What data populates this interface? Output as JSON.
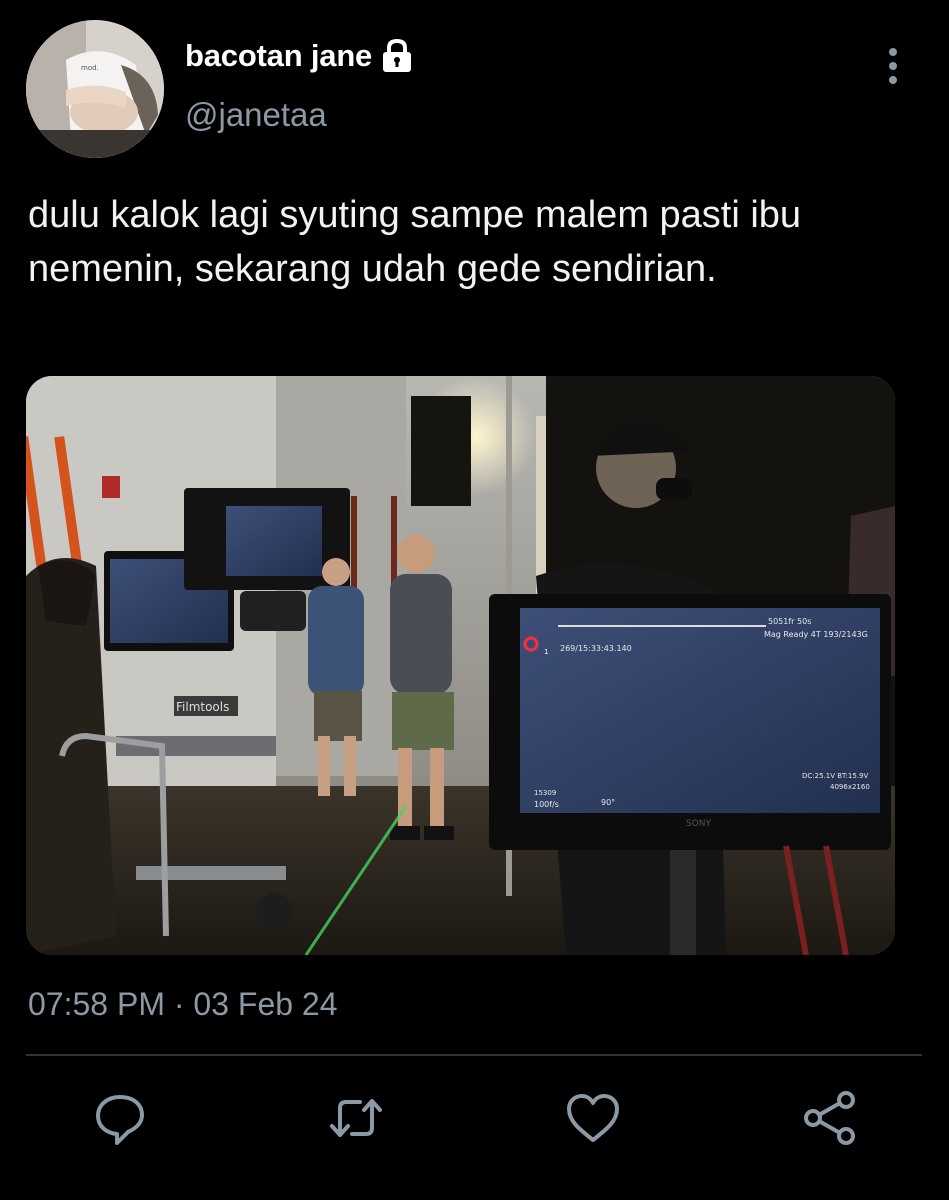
{
  "author": {
    "display_name": "bacotan jane",
    "handle": "@janetaa",
    "avatar_icon": "profile-photo",
    "protected_icon": "lock-icon"
  },
  "tweet": {
    "text": "dulu kalok lagi syuting sampe malem pasti ibu nemenin, sekarang udah gede sendirian.",
    "timestamp": "07:58 PM · 03 Feb 24"
  },
  "photo": {
    "description_icon": "film-set-photo",
    "monitor_overlay": {
      "timecode": "269/15:33:43.140",
      "top_right_1": "5051fr 50s",
      "top_right_2": "Mag Ready 4T 193/2143G",
      "bottom_left_1": "15309",
      "bottom_left_2": "100f/s",
      "bottom_mid": "90°",
      "bottom_right_1": "DC:25.1V BT:15.9V",
      "bottom_right_2": "4096x2160",
      "brand": "SONY",
      "cart_label": "Filmtools"
    }
  },
  "actions": {
    "reply_icon": "reply-icon",
    "retweet_icon": "retweet-icon",
    "like_icon": "heart-icon",
    "share_icon": "share-icon"
  },
  "colors": {
    "background": "#000000",
    "secondary_text": "#8b98a5",
    "divider": "#2f3336"
  }
}
